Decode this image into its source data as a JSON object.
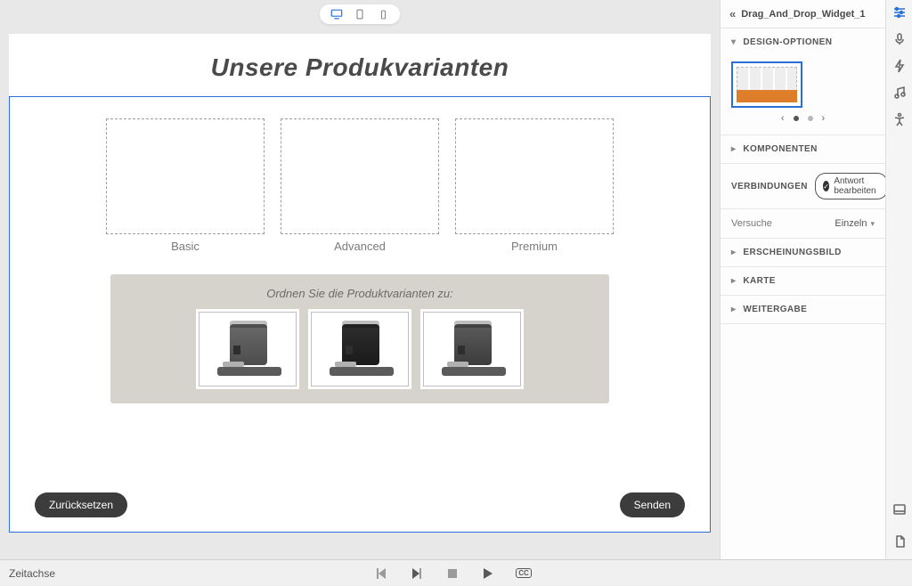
{
  "devicebar": {
    "active": "desktop"
  },
  "slide": {
    "title": "Unsere Produkvarianten",
    "dropzones": [
      {
        "label": "Basic"
      },
      {
        "label": "Advanced"
      },
      {
        "label": "Premium"
      }
    ],
    "source_title": "Ordnen Sie die Produktvarianten zu:",
    "cards": [
      {
        "name": "coffee-machine-1"
      },
      {
        "name": "coffee-machine-2"
      },
      {
        "name": "coffee-machine-3"
      }
    ],
    "reset_label": "Zurücksetzen",
    "send_label": "Senden"
  },
  "bottombar": {
    "timeline_label": "Zeitachse"
  },
  "inspector": {
    "widget_name": "Drag_And_Drop_Widget_1",
    "sections": {
      "design": "DESIGN-OPTIONEN",
      "komponenten": "KOMPONENTEN",
      "verbindungen": "VERBINDUNGEN",
      "antwort_btn": "Antwort bearbeiten",
      "versuche_label": "Versuche",
      "versuche_value": "Einzeln",
      "erscheinung": "ERSCHEINUNGSBILD",
      "karte": "KARTE",
      "weitergabe": "WEITERGABE"
    }
  }
}
